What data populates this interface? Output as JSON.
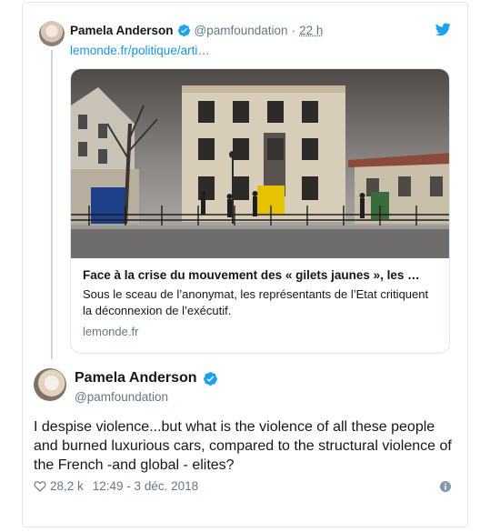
{
  "quoted_tweet": {
    "name": "Pamela Anderson",
    "handle": "@pamfoundation",
    "separator": "·",
    "time": "22 h",
    "link": "lemonde.fr/politique/arti…",
    "card": {
      "title": "Face à la crise du mouvement des « gilets jaunes », les …",
      "description": "Sous le sceau de l’anonymat, les représentants de l’Etat critiquent la déconnexion de l’exécutif.",
      "domain": "lemonde.fr"
    }
  },
  "main_tweet": {
    "name": "Pamela Anderson",
    "handle": "@pamfoundation",
    "text": "I despise violence...but what is the violence of all these people and burned luxurious cars, compared to the structural violence of the French -and global - elites?",
    "likes": "28,2 k",
    "timestamp": "12:49 - 3 déc. 2018"
  },
  "colors": {
    "accent": "#1da1f2",
    "link": "#1b95e0",
    "secondary_text": "#657786",
    "border": "#e1e8ed"
  },
  "icons": [
    "verified-badge-icon",
    "twitter-bird-icon",
    "heart-icon",
    "info-icon"
  ]
}
